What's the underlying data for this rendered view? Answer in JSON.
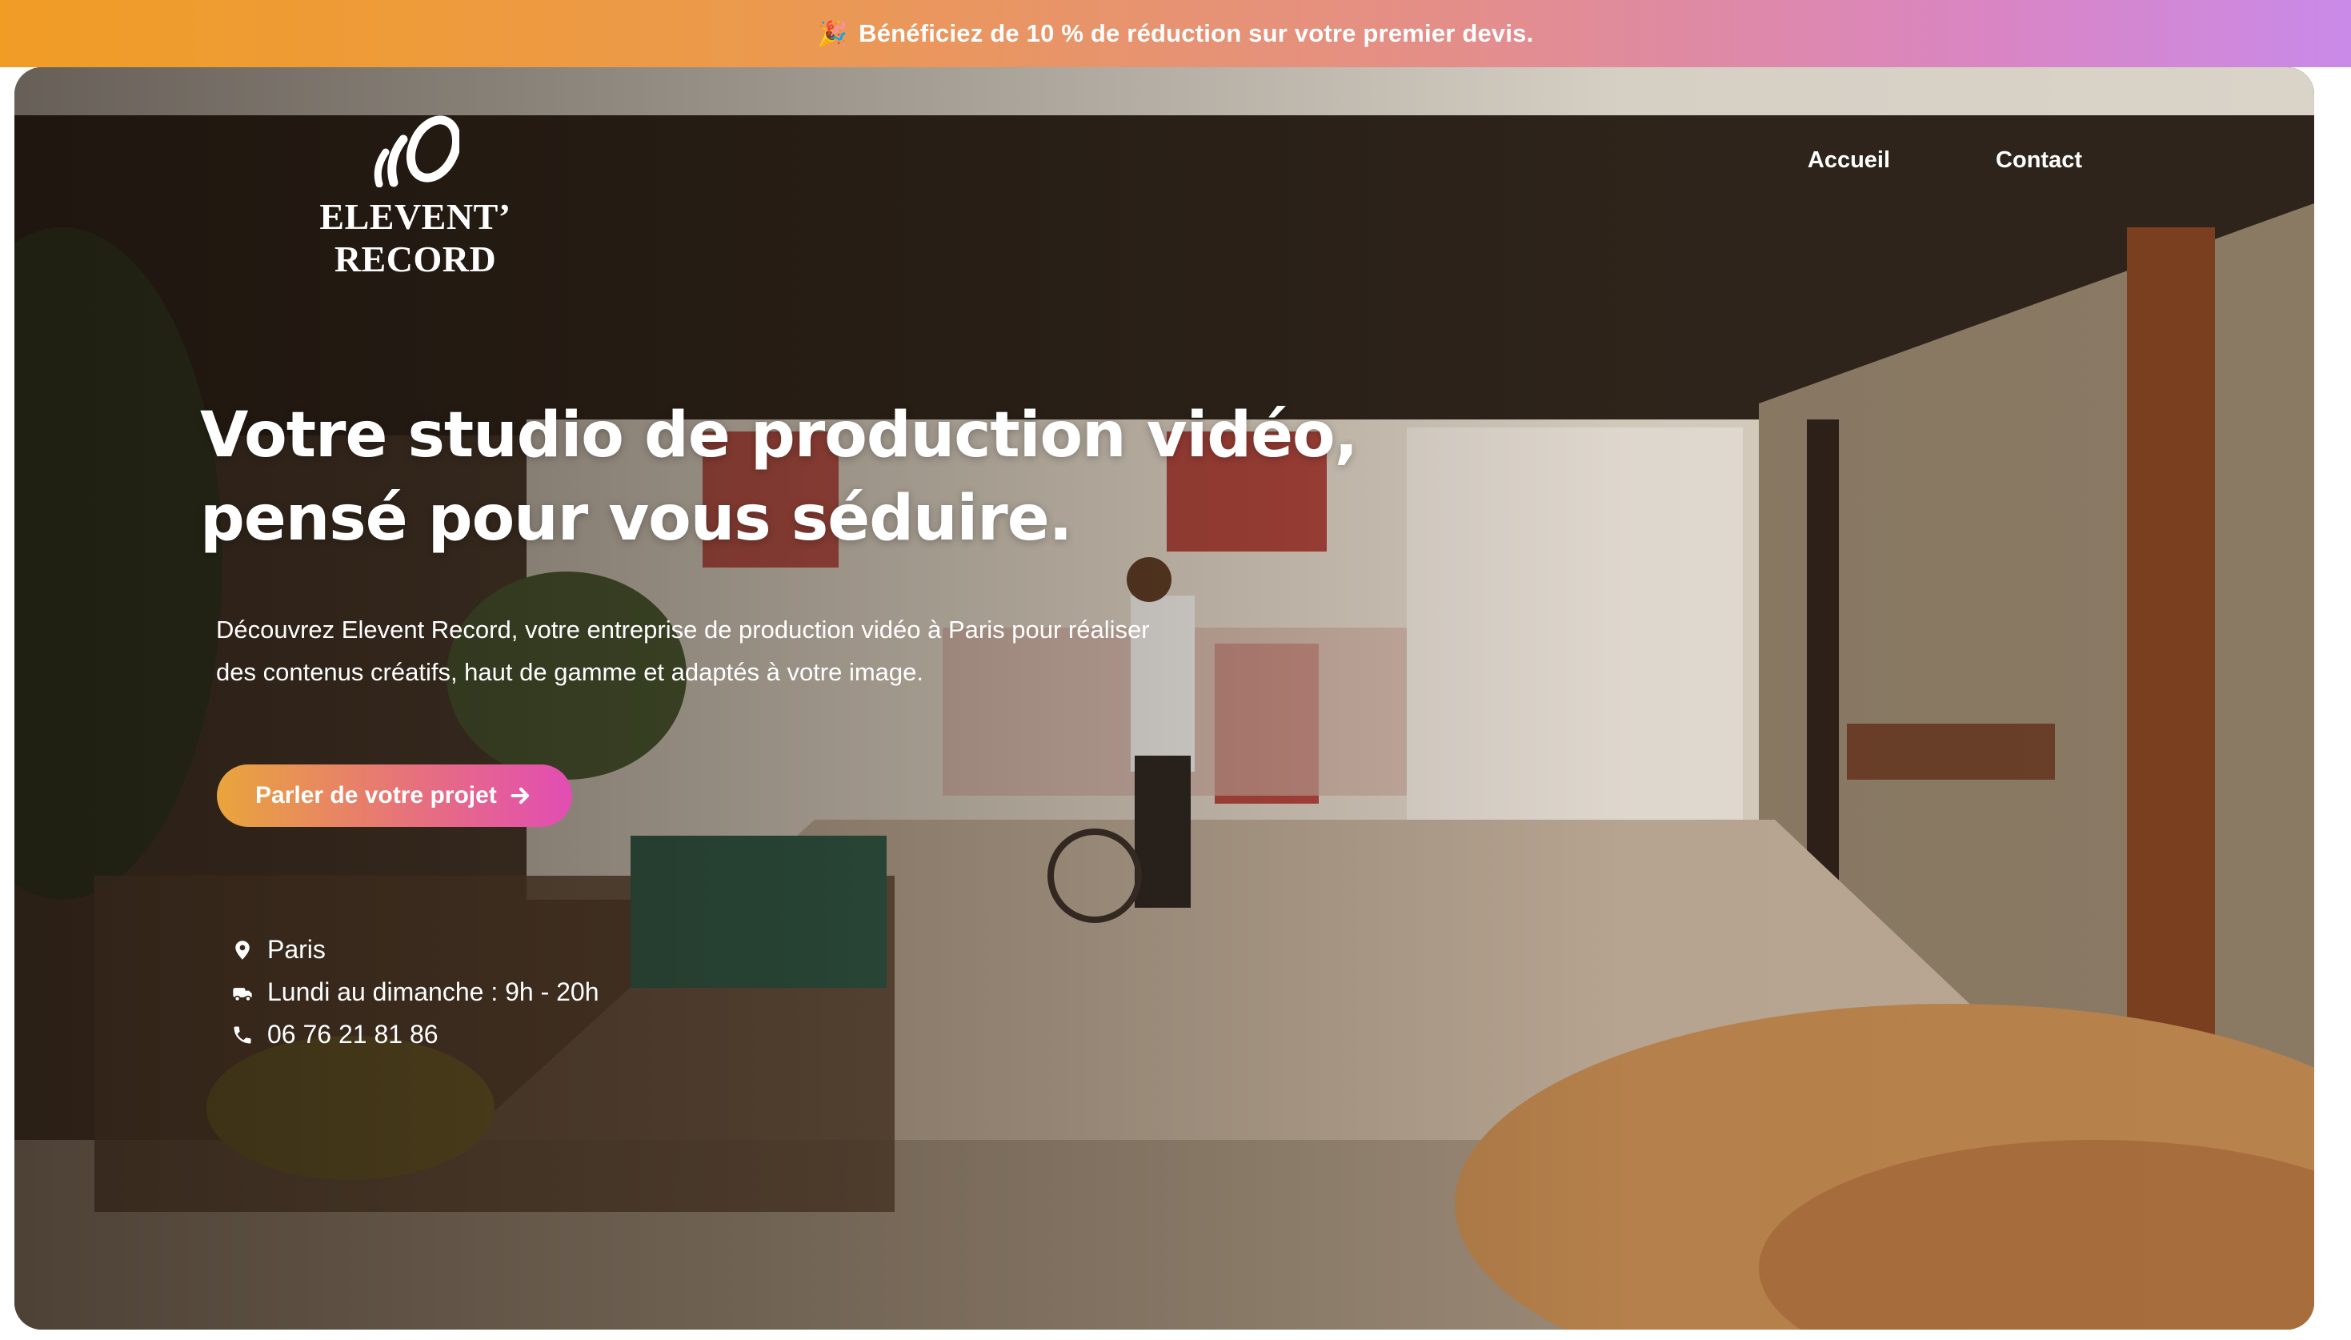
{
  "promo": {
    "emoji": "🎉",
    "text": "Bénéficiez de 10 % de réduction sur votre premier devis."
  },
  "brand": {
    "name": "ELEVENT’ RECORD"
  },
  "nav": {
    "items": [
      {
        "label": "Accueil"
      },
      {
        "label": "Contact"
      }
    ]
  },
  "hero": {
    "headline_line1": "Votre studio de production vidéo,",
    "headline_line2": "pensé pour vous séduire.",
    "description_line1": "Découvrez Elevent Record, votre entreprise de production vidéo à Paris pour réaliser",
    "description_line2": "des contenus créatifs, haut de gamme et adaptés à votre image.",
    "cta_label": "Parler de votre projet"
  },
  "info": [
    {
      "icon": "map-pin-icon",
      "text": "Paris"
    },
    {
      "icon": "clock-icon",
      "text": "Lundi au dimanche : 9h - 20h"
    },
    {
      "icon": "phone-icon",
      "text": "06 76 21 81 86"
    }
  ],
  "colors": {
    "promo_gradient": [
      "#f09c25",
      "#e48e8a",
      "#c98ae8"
    ],
    "cta_gradient": [
      "#e9a53c",
      "#e66d82",
      "#e24db3"
    ],
    "text": "#ffffff"
  }
}
